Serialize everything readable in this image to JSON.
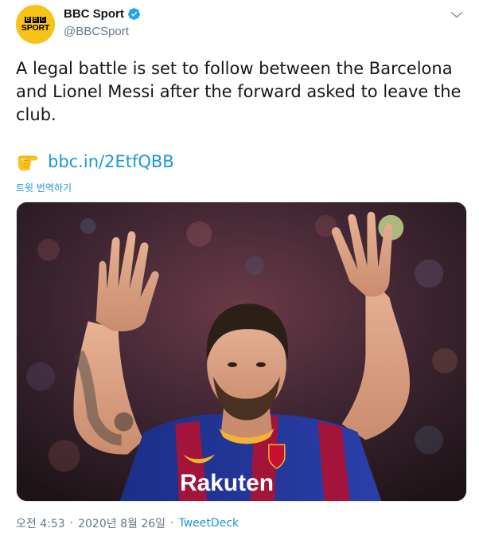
{
  "colors": {
    "accent": "#1b95e0",
    "text": "#14171a",
    "secondary": "#657786",
    "avatar_bg": "#f7c318",
    "verified": "#1da1f2"
  },
  "author": {
    "display_name": "BBC Sport",
    "handle": "@BBCSport",
    "verified": true,
    "avatar_icon": "bbc-sport-logo",
    "avatar_letters": [
      "B",
      "B",
      "C"
    ],
    "avatar_word": "SPORT"
  },
  "menu": {
    "icon": "chevron-down-icon"
  },
  "tweet": {
    "text": "A legal battle is set to follow between the Barcelona and Lionel Messi after the forward asked to leave the club.",
    "link_emoji_icon": "backhand-index-pointing-right-icon",
    "link_text": "bbc.in/2EtfQBB",
    "translate_label": "트윗 번역하기"
  },
  "media": {
    "jersey_sponsor": "Rakuten"
  },
  "meta": {
    "time": "오전 4:53",
    "separator": "·",
    "date": "2020년 8월 26일",
    "source": "TweetDeck"
  }
}
